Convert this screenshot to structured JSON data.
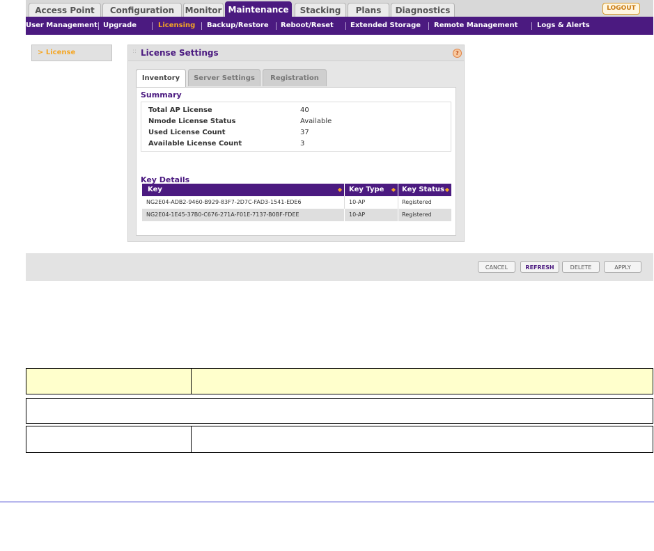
{
  "main_tabs": [
    {
      "label": "Access Point"
    },
    {
      "label": "Configuration"
    },
    {
      "label": "Monitor"
    },
    {
      "label": "Maintenance"
    },
    {
      "label": "Stacking"
    },
    {
      "label": "Plans"
    },
    {
      "label": "Diagnostics"
    }
  ],
  "logout_label": "LOGOUT",
  "sub_nav": [
    {
      "label": "User Management"
    },
    {
      "label": "Upgrade"
    },
    {
      "label": "Licensing"
    },
    {
      "label": "Backup/Restore"
    },
    {
      "label": "Reboot/Reset"
    },
    {
      "label": "Extended Storage"
    },
    {
      "label": "Remote Management"
    },
    {
      "label": "Logs & Alerts"
    }
  ],
  "left_nav": {
    "item": "> License"
  },
  "panel": {
    "title": "License Settings",
    "help_glyph": "?",
    "tabs": [
      {
        "label": "Inventory"
      },
      {
        "label": "Server Settings"
      },
      {
        "label": "Registration"
      }
    ],
    "summary_title": "Summary",
    "summary": [
      {
        "label": "Total AP License",
        "value": "40"
      },
      {
        "label": "Nmode License Status",
        "value": "Available"
      },
      {
        "label": "Used License Count",
        "value": "37"
      },
      {
        "label": "Available License Count",
        "value": "3"
      }
    ],
    "key_details_title": "Key Details",
    "key_columns": {
      "key": "Key",
      "type": "Key Type",
      "status": "Key Status"
    },
    "keys": [
      {
        "key": "NG2E04-ADB2-9460-B929-83F7-2D7C-FAD3-1541-EDE6",
        "type": "10-AP",
        "status": "Registered"
      },
      {
        "key": "NG2E04-1E45-37B0-C676-271A-F01E-7137-B0BF-FDEE",
        "type": "10-AP",
        "status": "Registered"
      }
    ]
  },
  "buttons": {
    "cancel": "CANCEL",
    "refresh": "REFRESH",
    "delete": "DELETE",
    "apply": "APPLY"
  },
  "colors": {
    "brand_purple": "#4b1a80",
    "accent_orange": "#f5a623"
  }
}
